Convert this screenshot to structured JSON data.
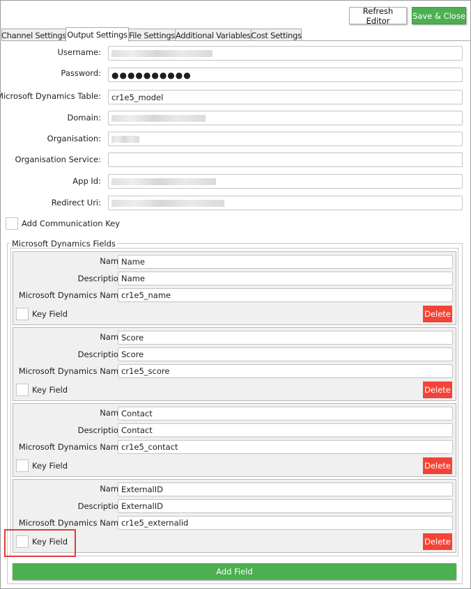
{
  "toolbar": {
    "refresh_label": "Refresh Editor",
    "save_close_label": "Save & Close"
  },
  "tabs": [
    {
      "label": "Channel Settings",
      "active": false
    },
    {
      "label": "Output Settings",
      "active": true
    },
    {
      "label": "File Settings",
      "active": false
    },
    {
      "label": "Additional Variables",
      "active": false
    },
    {
      "label": "Cost Settings",
      "active": false
    }
  ],
  "form": {
    "username_label": "Username:",
    "password_label": "Password:",
    "password_value": "●●●●●●●●●●",
    "table_label": "Microsoft Dynamics Table:",
    "table_value": "cr1e5_model",
    "domain_label": "Domain:",
    "organisation_label": "Organisation:",
    "org_service_label": "Organisation Service:",
    "org_service_value": "",
    "app_id_label": "App Id:",
    "redirect_uri_label": "Redirect Uri:",
    "comm_key_label": "Add Communication Key"
  },
  "fields_group": {
    "title": "Microsoft Dynamics Fields",
    "name_label": "Name:",
    "description_label": "Description:",
    "dynamics_name_label": "Microsoft Dynamics Name:",
    "key_field_label": "Key Field",
    "delete_label": "Delete",
    "items": [
      {
        "name": "Name",
        "description": "Name",
        "dynamics_name": "cr1e5_name"
      },
      {
        "name": "Score",
        "description": "Score",
        "dynamics_name": "cr1e5_score"
      },
      {
        "name": "Contact",
        "description": "Contact",
        "dynamics_name": "cr1e5_contact"
      },
      {
        "name": "ExternalID",
        "description": "ExternalID",
        "dynamics_name": "cr1e5_externalid"
      }
    ],
    "add_field_label": "Add Field"
  },
  "colors": {
    "green": "#4caf50",
    "red": "#f44336",
    "highlight": "#e53935"
  }
}
